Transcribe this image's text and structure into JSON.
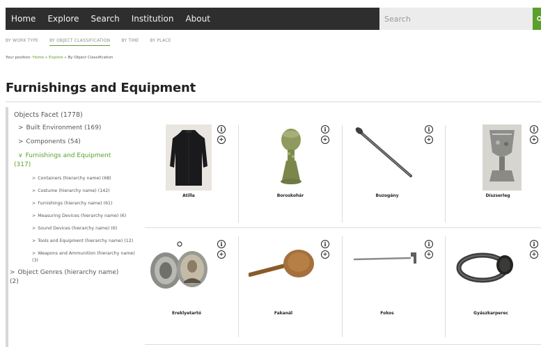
{
  "nav": {
    "items": [
      "Home",
      "Explore",
      "Search",
      "Institution",
      "About"
    ],
    "search_placeholder": "Search",
    "search_button_icon": "search-icon"
  },
  "subnav": {
    "items": [
      "BY WORK TYPE",
      "BY OBJECT CLASSIFICATION",
      "BY TIME",
      "BY PLACE"
    ],
    "active": "BY OBJECT CLASSIFICATION"
  },
  "breadcrumb": {
    "prefix": "Your position:",
    "home": "Home",
    "sep1": "»",
    "explore": "Explore",
    "sep2": "»",
    "current": "By Object Classification"
  },
  "page": {
    "title": "Furnishings and Equipment"
  },
  "facet": {
    "head": "Objects Facet (1778)",
    "top_items": [
      {
        "label": "Built Environment (169)"
      },
      {
        "label": "Components (54)"
      }
    ],
    "active_item": {
      "label": "Furnishings and Equipment",
      "count": "(317)"
    },
    "sub_items": [
      {
        "label": "Containers (hierarchy name) (68)"
      },
      {
        "label": "Costume (hierarchy name) (142)"
      },
      {
        "label": "Furnishings (hierarchy name) (61)"
      },
      {
        "label": "Measuring Devices (hierarchy name) (6)"
      },
      {
        "label": "Sound Devices (hierarchy name) (6)"
      },
      {
        "label": "Tools and Equipment (hierarchy name) (12)"
      },
      {
        "label": "Weapons and Ammunition (hierarchy name) (3)"
      }
    ],
    "after_item": {
      "label": "Object Genres (hierarchy name)",
      "count": "(2)"
    }
  },
  "objects": [
    {
      "caption": "Atilla"
    },
    {
      "caption": "Boroskohár"
    },
    {
      "caption": "Buzogány"
    },
    {
      "caption": "Díszserleg"
    },
    {
      "caption": "Ereklyetartó"
    },
    {
      "caption": "Fakanál"
    },
    {
      "caption": "Fokos"
    },
    {
      "caption": "Gyászkarperec"
    }
  ],
  "icons": {
    "info": "i",
    "add": "+"
  }
}
